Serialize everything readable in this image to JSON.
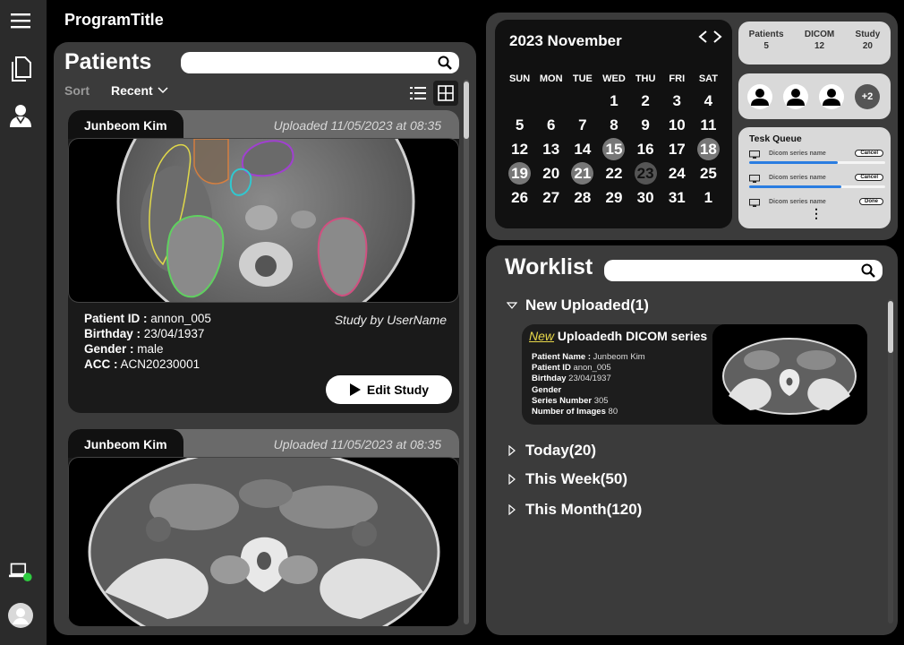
{
  "app": {
    "title": "ProgramTitle"
  },
  "rail": {
    "icons": [
      "menu-icon",
      "documents-icon",
      "doctor-icon",
      "laptop-status-icon",
      "user-avatar-icon"
    ],
    "status_color": "#2ecc40"
  },
  "patients": {
    "title": "Patients",
    "search": {
      "placeholder": ""
    },
    "sort_label": "Sort",
    "sort_value": "Recent",
    "cards": [
      {
        "name": "Junbeom Kim",
        "uploaded": "Uploaded  11/05/2023 at 08:35",
        "patient_id_label": "Patient ID :",
        "patient_id": "annon_005",
        "birthday_label": "Birthday :",
        "birthday": "23/04/1937",
        "gender_label": "Gender :",
        "gender": "male",
        "acc_label": "ACC :",
        "acc": "ACN20230001",
        "study_by": "Study by UserName",
        "edit_label": "Edit Study"
      },
      {
        "name": "Junbeom Kim",
        "uploaded": "Uploaded  11/05/2023 at 08:35"
      }
    ]
  },
  "calendar": {
    "month": "2023 November",
    "weekdays": [
      "SUN",
      "MON",
      "TUE",
      "WED",
      "THU",
      "FRI",
      "SAT"
    ],
    "days": [
      "",
      "",
      "",
      "1",
      "2",
      "3",
      "4",
      "5",
      "6",
      "7",
      "8",
      "9",
      "10",
      "11",
      "12",
      "13",
      "14",
      "15",
      "16",
      "17",
      "18",
      "19",
      "20",
      "21",
      "22",
      "23",
      "24",
      "25",
      "26",
      "27",
      "28",
      "29",
      "30",
      "31",
      "1"
    ],
    "marked": [
      "15",
      "18",
      "19",
      "21"
    ],
    "dark_marked": [
      "23"
    ]
  },
  "stats": [
    {
      "label": "Patients",
      "value": "5"
    },
    {
      "label": "DICOM",
      "value": "12"
    },
    {
      "label": "Study",
      "value": "20"
    }
  ],
  "users": {
    "more": "+2"
  },
  "queue": {
    "title": "Tesk Queue",
    "items": [
      {
        "name": "Dicom series name",
        "action": "Cancel",
        "progress": 0.65
      },
      {
        "name": "Dicom series name",
        "action": "Cancel",
        "progress": 0.68
      },
      {
        "name": "Dicom series name",
        "action": "Done",
        "progress": null
      }
    ],
    "more": "⋮"
  },
  "worklist": {
    "title": "Worklist",
    "search": {
      "placeholder": ""
    },
    "groups": [
      {
        "label": "New Uploaded(1)",
        "expanded": true
      },
      {
        "label": "Today(20)",
        "expanded": false
      },
      {
        "label": "This Week(50)",
        "expanded": false
      },
      {
        "label": "This Month(120)",
        "expanded": false
      }
    ],
    "series": {
      "new_tag": "New",
      "title": " Uploadedh DICOM series",
      "fields": [
        {
          "label": "Patient Name :",
          "value": " Junbeom Kim"
        },
        {
          "label": "Patient ID",
          "value": " anon_005"
        },
        {
          "label": "Birthday",
          "value": " 23/04/1937"
        },
        {
          "label": "Gender",
          "value": ""
        },
        {
          "label": "Series Number",
          "value": " 305"
        },
        {
          "label": "Number of Images",
          "value": " 80"
        }
      ]
    }
  }
}
